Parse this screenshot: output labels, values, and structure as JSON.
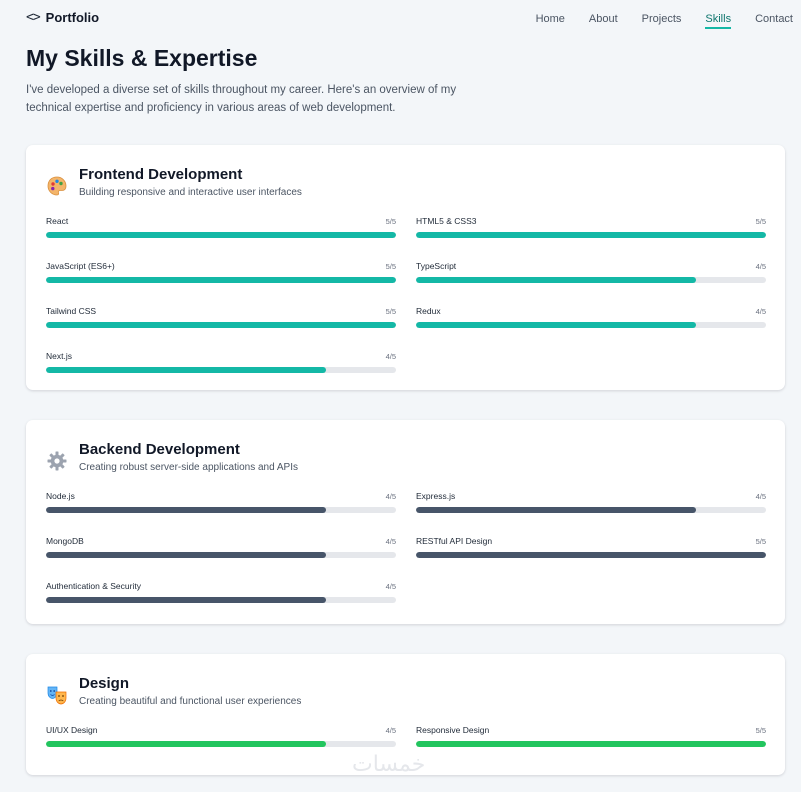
{
  "nav": {
    "brand_icon": "<>",
    "brand_name": "Portfolio",
    "links": [
      "Home",
      "About",
      "Projects",
      "Skills",
      "Contact"
    ],
    "active": "Skills",
    "accent": "#14b8a6"
  },
  "hero": {
    "title": "My Skills & Expertise",
    "description": "I've developed a diverse set of skills throughout my career. Here's an overview of my technical expertise and proficiency in various areas of web development."
  },
  "categories": [
    {
      "icon": "palette-icon",
      "title": "Frontend Development",
      "subtitle": "Building responsive and interactive user interfaces",
      "bar_color": "#14b8a6",
      "skills": [
        {
          "name": "React",
          "level": "5/5",
          "value": 1.0
        },
        {
          "name": "HTML5 & CSS3",
          "level": "5/5",
          "value": 1.0
        },
        {
          "name": "JavaScript (ES6+)",
          "level": "5/5",
          "value": 1.0
        },
        {
          "name": "TypeScript",
          "level": "4/5",
          "value": 0.8
        },
        {
          "name": "Tailwind CSS",
          "level": "5/5",
          "value": 1.0
        },
        {
          "name": "Redux",
          "level": "4/5",
          "value": 0.8
        },
        {
          "name": "Next.js",
          "level": "4/5",
          "value": 0.8
        }
      ]
    },
    {
      "icon": "gear-icon",
      "title": "Backend Development",
      "subtitle": "Creating robust server-side applications and APIs",
      "bar_color": "#475569",
      "skills": [
        {
          "name": "Node.js",
          "level": "4/5",
          "value": 0.8
        },
        {
          "name": "Express.js",
          "level": "4/5",
          "value": 0.8
        },
        {
          "name": "MongoDB",
          "level": "4/5",
          "value": 0.8
        },
        {
          "name": "RESTful API Design",
          "level": "5/5",
          "value": 1.0
        },
        {
          "name": "Authentication & Security",
          "level": "4/5",
          "value": 0.8
        }
      ]
    },
    {
      "icon": "theater-masks-icon",
      "title": "Design",
      "subtitle": "Creating beautiful and functional user experiences",
      "bar_color": "#22c55e",
      "skills": [
        {
          "name": "UI/UX Design",
          "level": "4/5",
          "value": 0.8
        },
        {
          "name": "Responsive Design",
          "level": "5/5",
          "value": 1.0
        }
      ]
    }
  ],
  "watermark": "خمسات"
}
